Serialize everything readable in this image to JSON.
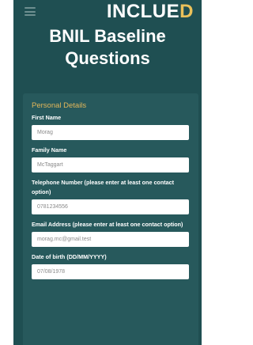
{
  "header": {
    "menu_icon": "hamburger-menu-icon",
    "logo_main": "INCLUE",
    "logo_accent": "D"
  },
  "page": {
    "title_line1": "BNIL Baseline",
    "title_line2": "Questions"
  },
  "form": {
    "section_title": "Personal Details",
    "fields": [
      {
        "label": "First Name",
        "value": "Morag"
      },
      {
        "label": "Family Name",
        "value": "McTaggart"
      },
      {
        "label": "Telephone Number (please enter at least one contact option)",
        "value": "0781234556"
      },
      {
        "label": "Email Address (please enter at least one contact option)",
        "value": "morag.mc@gmail.test"
      },
      {
        "label": "Date of birth (DD/MM/YYYY)",
        "value": "07/08/1978"
      }
    ]
  },
  "colors": {
    "background": "#1f4f52",
    "card": "#27595c",
    "accent": "#e3b75a"
  }
}
